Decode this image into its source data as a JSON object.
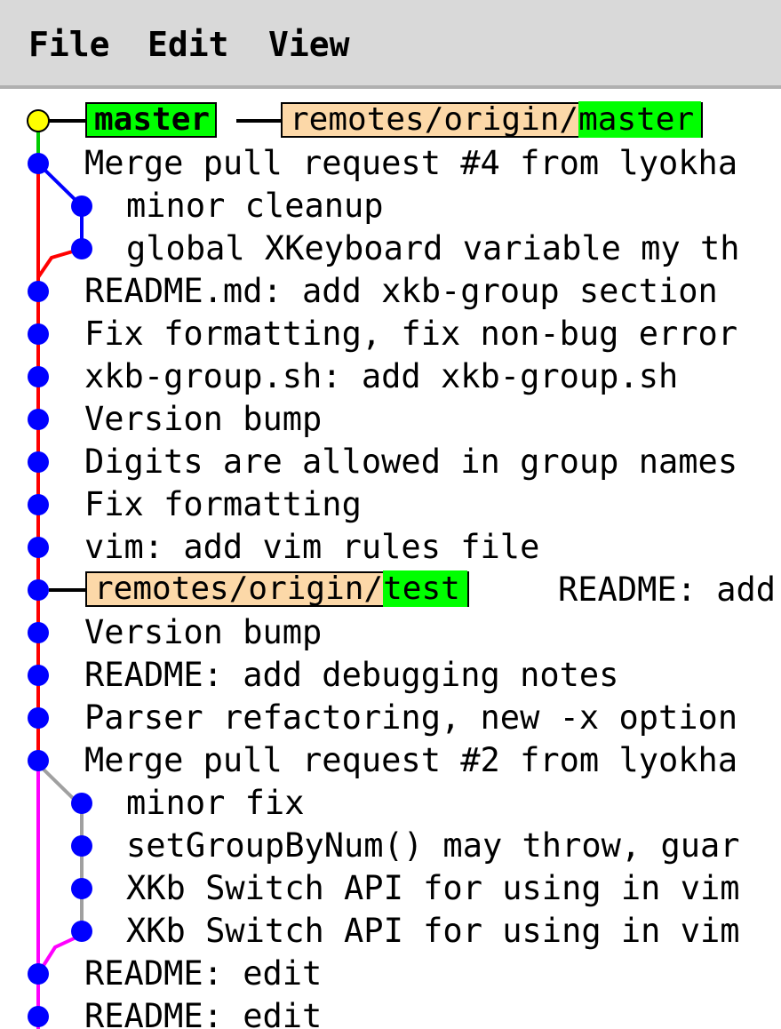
{
  "menu": {
    "file": "File",
    "edit": "Edit",
    "view": "View"
  },
  "refs": {
    "master": "master",
    "remote_master_prefix": "remotes/origin/",
    "remote_master_branch": "master",
    "remote_test_prefix": "remotes/origin/",
    "remote_test_branch": "test"
  },
  "commits": [
    {
      "message": "Merge pull request #4 from lyokha"
    },
    {
      "message": "minor cleanup"
    },
    {
      "message": "global XKeyboard variable my th"
    },
    {
      "message": "README.md: add xkb-group section"
    },
    {
      "message": "Fix formatting, fix non-bug error"
    },
    {
      "message": "xkb-group.sh: add xkb-group.sh"
    },
    {
      "message": "Version bump"
    },
    {
      "message": "Digits are allowed in group names"
    },
    {
      "message": "Fix formatting"
    },
    {
      "message": "vim: add vim rules file"
    },
    {
      "message": "README: add"
    },
    {
      "message": "Version bump"
    },
    {
      "message": "README: add debugging notes"
    },
    {
      "message": "Parser refactoring, new -x option"
    },
    {
      "message": "Merge pull request #2 from lyokha"
    },
    {
      "message": "minor fix"
    },
    {
      "message": "setGroupByNum() may throw, guar"
    },
    {
      "message": "XKb Switch API for using in vim"
    },
    {
      "message": "XKb Switch API for using in vim"
    },
    {
      "message": "README: edit"
    },
    {
      "message": "README: edit"
    }
  ],
  "colors": {
    "head_dot": "#ffff00",
    "commit_dot": "#0000ff",
    "main_line": "#ff0000",
    "branch_blue": "#0000ff",
    "branch_magenta": "#ff00ff",
    "branch_gray": "#a0a0a0",
    "green_line": "#00cc00",
    "local_ref_bg": "#00ff00",
    "remote_ref_bg": "#fcd8a8"
  }
}
